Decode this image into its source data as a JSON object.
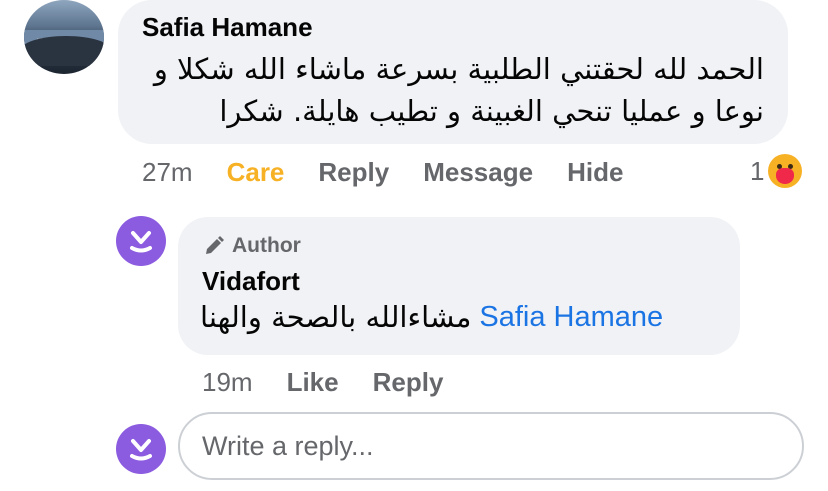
{
  "comment": {
    "author": "Safia Hamane",
    "text": "الحمد لله لحقتني الطلبية بسرعة ماشاء الله شكلا و نوعا و عمليا  تنحي الغبينة و تطيب هايلة. شكرا",
    "time": "27m",
    "actions": [
      "Care",
      "Reply",
      "Message",
      "Hide"
    ],
    "reaction_count": "1",
    "reaction_icon": "care-emoji"
  },
  "reply": {
    "badge": "Author",
    "badge_icon": "pencil-icon",
    "author": "Vidafort",
    "text_arabic": "مشاءالله بالصحة والهنا",
    "mention": "Safia Hamane",
    "time": "19m",
    "actions": [
      "Like",
      "Reply"
    ]
  },
  "composer": {
    "placeholder": "Write a reply..."
  },
  "colors": {
    "bubble": "#f0f2f5",
    "care": "#f7b125",
    "mention": "#1b74e4",
    "brand_avatar": "#8b5be0",
    "muted": "#65676b"
  }
}
